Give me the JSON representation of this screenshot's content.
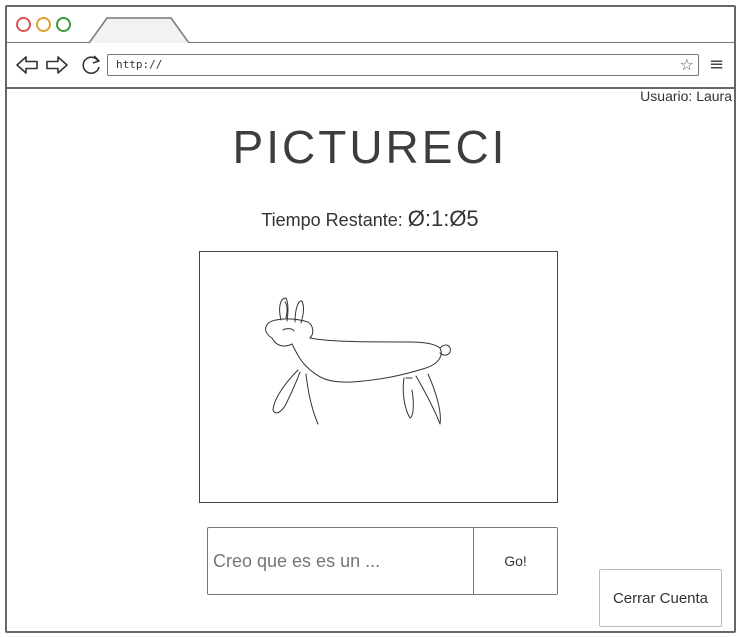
{
  "browser": {
    "address": "http://",
    "star_glyph": "☆",
    "menu_glyph": "≡"
  },
  "header": {
    "user_label": "Usuario: Laura"
  },
  "main": {
    "title": "PICTURECI",
    "timer_label": "Tiempo Restante:",
    "timer_value": "Ø:1:Ø5",
    "canvas_icon": "dog-sketch",
    "guess_placeholder": "Creo que es es un ...",
    "go_label": "Go!",
    "logout_label": "Cerrar Cuenta"
  }
}
